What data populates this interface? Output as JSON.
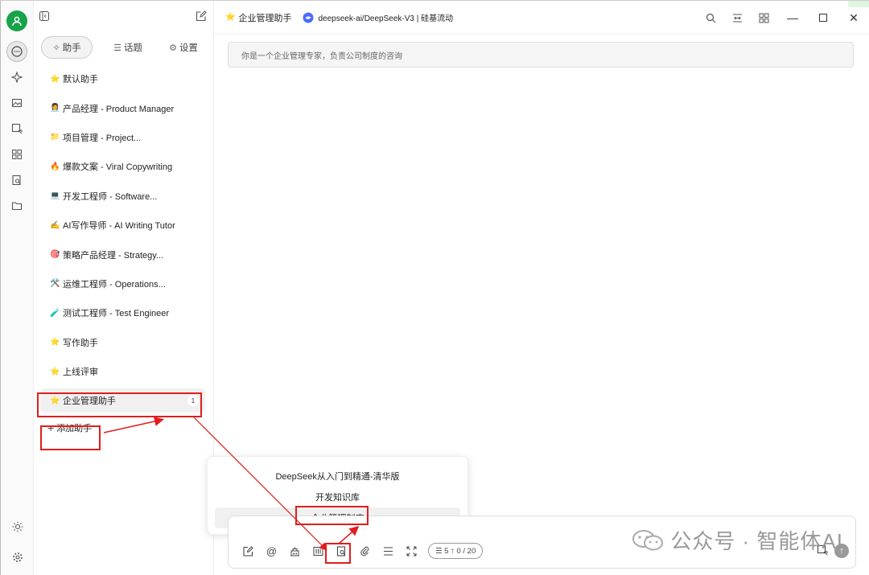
{
  "sidebar": {
    "tabs": [
      {
        "label": "助手",
        "icon": "sparkle-icon"
      },
      {
        "label": "话题",
        "icon": "list-icon"
      },
      {
        "label": "设置",
        "icon": "gear-icon"
      }
    ],
    "items": [
      {
        "emoji": "⭐",
        "label": "默认助手"
      },
      {
        "emoji": "👩‍💼",
        "label": "产品经理 - Product Manager"
      },
      {
        "emoji": "📁",
        "label": "项目管理 - Project..."
      },
      {
        "emoji": "🔥",
        "label": "爆款文案 - Viral Copywriting"
      },
      {
        "emoji": "💻",
        "label": "开发工程师 - Software..."
      },
      {
        "emoji": "✍️",
        "label": "AI写作导师 - AI Writing Tutor"
      },
      {
        "emoji": "🎯",
        "label": "策略产品经理 - Strategy..."
      },
      {
        "emoji": "🛠️",
        "label": "运维工程师 - Operations..."
      },
      {
        "emoji": "🧪",
        "label": "测试工程师 - Test Engineer"
      },
      {
        "emoji": "⭐",
        "label": "写作助手"
      },
      {
        "emoji": "⭐",
        "label": "上线评审"
      }
    ],
    "selected": {
      "emoji": "⭐",
      "label": "企业管理助手",
      "badge": "1"
    },
    "add_label": "添加助手"
  },
  "topbar": {
    "title": "企业管理助手",
    "model": "deepseek-ai/DeepSeek-V3 | 硅基流动"
  },
  "main": {
    "system_prompt": "你是一个企业管理专家，负责公司制度的咨询"
  },
  "popup": {
    "items": [
      "DeepSeek从入门到精通-清华版",
      "开发知识库",
      "企业管理制度"
    ]
  },
  "input": {
    "token_info": "☰ 5  ↑ 0 / 20"
  },
  "watermark": "公众号 · 智能体AI",
  "colors": {
    "accent": "#16a34a",
    "highlight": "#e11d1d"
  }
}
